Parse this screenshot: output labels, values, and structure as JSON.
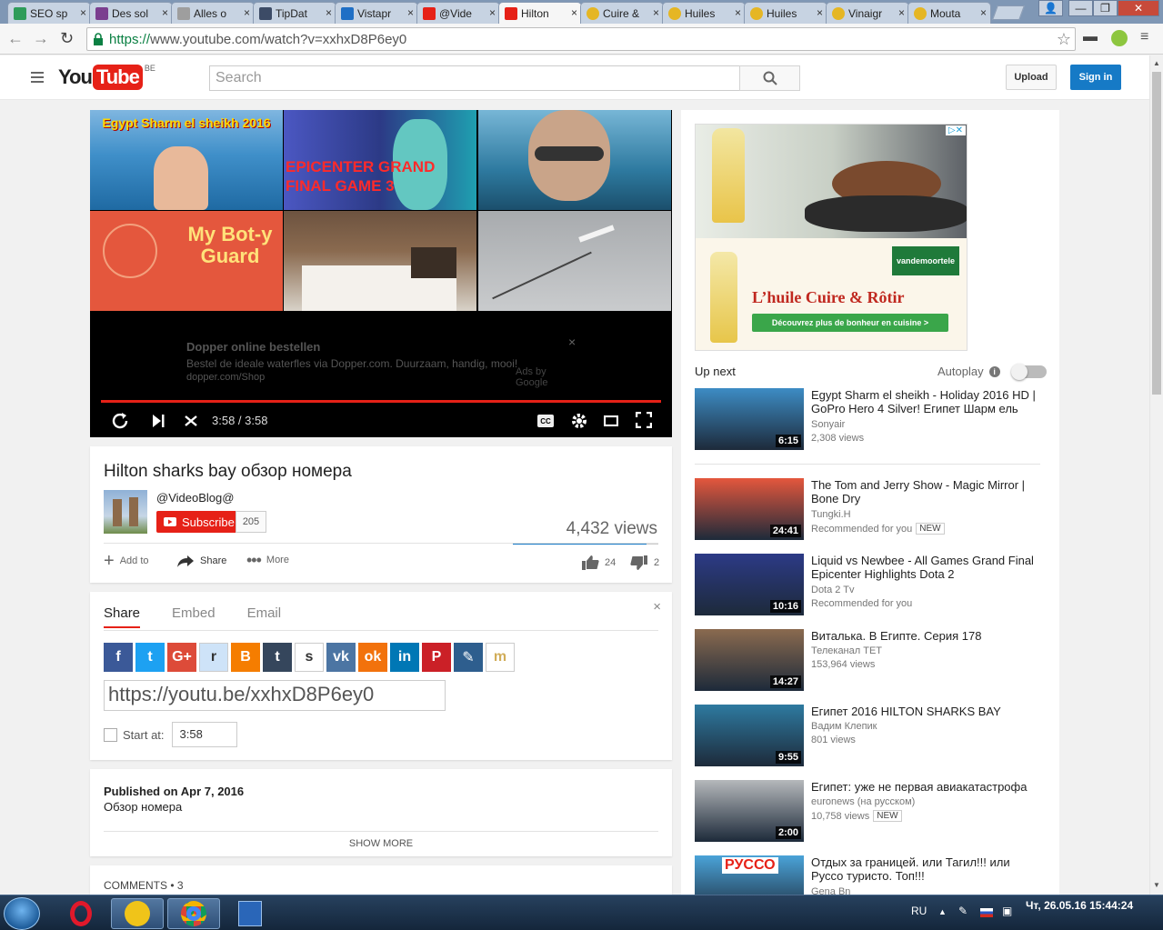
{
  "browser": {
    "tabs": [
      {
        "label": "SEO sp",
        "favicon_color": "#2e9c5a"
      },
      {
        "label": "Des sol",
        "favicon_color": "#7b3f8f"
      },
      {
        "label": "Alles o",
        "favicon_color": "#9e9e9e"
      },
      {
        "label": "TipDat",
        "favicon_color": "#3c4b66"
      },
      {
        "label": "Vistapr",
        "favicon_color": "#1f6fc5"
      },
      {
        "label": "@Vide",
        "favicon_color": "#e62117"
      },
      {
        "label": "Hilton",
        "favicon_color": "#e62117",
        "active": true
      },
      {
        "label": "Cuire &",
        "favicon_color": "#e5b624"
      },
      {
        "label": "Huiles",
        "favicon_color": "#e5b624"
      },
      {
        "label": "Huiles",
        "favicon_color": "#e5b624"
      },
      {
        "label": "Vinaigr",
        "favicon_color": "#e5b624"
      },
      {
        "label": "Mouta",
        "favicon_color": "#e5b624"
      }
    ],
    "tab_close": "×",
    "url_scheme": "https://",
    "url_rest": "www.youtube.com/watch?v=xxhxD8P6ey0",
    "window_buttons": [
      "—",
      "❐",
      "✕"
    ]
  },
  "header": {
    "logo_you": "You",
    "logo_tube": "Tube",
    "country": "BE",
    "search_placeholder": "Search",
    "upload": "Upload",
    "sign_in": "Sign in"
  },
  "player": {
    "thumbs": [
      {
        "caption": "Egypt Sharm el sheikh 2016",
        "bg": "#3f8fc9"
      },
      {
        "caption": "EPICENTER GRAND FINAL GAME 3",
        "bg": "#2c3a86"
      },
      {
        "caption": "",
        "bg": "#2e7aa0"
      },
      {
        "caption": "My Bot-y Guard",
        "bg": "#e4573d"
      },
      {
        "caption": "",
        "bg": "#8a6a4f"
      },
      {
        "caption": "",
        "bg": "#b5b8bb"
      }
    ],
    "ad_title": "Dopper online bestellen",
    "ad_text": "Bestel de ideale waterfles via Dopper.com. Duurzaam, handig, mooi!",
    "ad_url": "dopper.com/Shop",
    "ad_by": "Ads by Google",
    "ad_close": "×",
    "time": "3:58 / 3:58",
    "cc": "CC",
    "progress": 1.0
  },
  "video": {
    "title": "Hilton sharks bay обзор номера",
    "channel": "@VideoBlog@",
    "subscribe": "Subscribe",
    "sub_count": "205",
    "views": "4,432 views",
    "add_to": "Add to",
    "share": "Share",
    "more": "More",
    "likes": "24",
    "dislikes": "2",
    "like_ratio": 0.92
  },
  "share": {
    "tabs": [
      "Share",
      "Embed",
      "Email"
    ],
    "close": "×",
    "networks": [
      {
        "name": "facebook",
        "color": "#3b5998",
        "glyph": "f"
      },
      {
        "name": "twitter",
        "color": "#1da1f2",
        "glyph": "t"
      },
      {
        "name": "google-plus",
        "color": "#dd4b39",
        "glyph": "G+"
      },
      {
        "name": "reddit",
        "color": "#cee3f8",
        "glyph": "r"
      },
      {
        "name": "blogger",
        "color": "#f57d00",
        "glyph": "B"
      },
      {
        "name": "tumblr",
        "color": "#35465c",
        "glyph": "t"
      },
      {
        "name": "stumbleupon",
        "color": "#ffffff",
        "glyph": "s"
      },
      {
        "name": "vk",
        "color": "#4c75a3",
        "glyph": "vk"
      },
      {
        "name": "odnoklassniki",
        "color": "#f2720c",
        "glyph": "ok"
      },
      {
        "name": "linkedin",
        "color": "#0077b5",
        "glyph": "in"
      },
      {
        "name": "pinterest",
        "color": "#cb2027",
        "glyph": "P"
      },
      {
        "name": "livejournal",
        "color": "#2e5e8e",
        "glyph": "✎"
      },
      {
        "name": "mixi",
        "color": "#ffffff",
        "glyph": "m"
      }
    ],
    "url": "https://youtu.be/xxhxD8P6ey0",
    "start_label": "Start at:",
    "start_value": "3:58"
  },
  "description": {
    "published": "Published on Apr 7, 2016",
    "text": "Обзор номера",
    "show_more": "SHOW MORE"
  },
  "comments": {
    "label": "COMMENTS • 3"
  },
  "sidebar": {
    "ad_headline": "L’huile Cuire & Rôtir",
    "ad_cta": "Découvrez plus de bonheur en cuisine >",
    "ad_brand": "vandemoortele",
    "up_next": "Up next",
    "autoplay": "Autoplay",
    "videos": [
      {
        "title": "Egypt Sharm el sheikh - Holiday 2016 HD | GoPro Hero 4 Silver! Египет Шарм ель",
        "channel": "Sonyair",
        "meta": "2,308 views",
        "badge": "",
        "duration": "6:15",
        "thumb": "#3d8cc4"
      },
      {
        "title": "The Tom and Jerry Show - Magic Mirror | Bone Dry",
        "channel": "Tungki.H",
        "meta": "Recommended for you",
        "badge": "NEW",
        "duration": "24:41",
        "thumb": "#e4573d"
      },
      {
        "title": "Liquid vs Newbee - All Games Grand Final Epicenter Highlights Dota 2",
        "channel": "Dota 2 Tv",
        "meta": "Recommended for you",
        "badge": "",
        "duration": "10:16",
        "thumb": "#2c3a86"
      },
      {
        "title": "Виталька. В Египте. Серия 178",
        "channel": "Телеканал ТЕТ",
        "meta": "153,964 views",
        "badge": "",
        "duration": "14:27",
        "thumb": "#8a6a4f"
      },
      {
        "title": "Египет 2016 HILTON SHARKS BAY",
        "channel": "Вадим Клепик",
        "meta": "801 views",
        "badge": "",
        "duration": "9:55",
        "thumb": "#2e7aa0"
      },
      {
        "title": "Египет: уже не первая авиакатастрофа",
        "channel": "euronews (на русском)",
        "meta": "10,758 views",
        "badge": "NEW",
        "duration": "2:00",
        "thumb": "#b5b8bb"
      },
      {
        "title": "Отдых за границей. или Тагил!!! или Руссо туристо. Топ!!!",
        "channel": "Gena Bn",
        "meta": "",
        "badge": "",
        "duration": "",
        "thumb": "#4aa3d8",
        "thumb_text": "РУССО"
      }
    ]
  },
  "taskbar": {
    "lang": "RU",
    "clock": "Чт, 26.05.16 15:44:24"
  }
}
